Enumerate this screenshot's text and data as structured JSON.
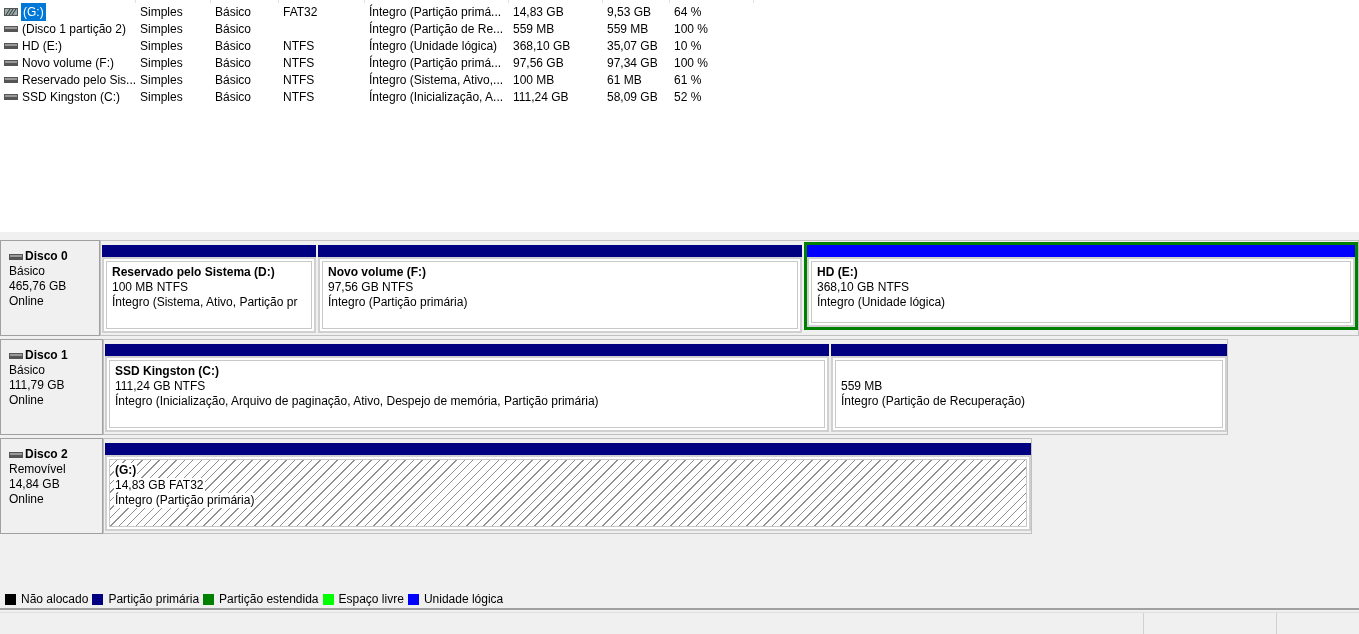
{
  "volumes": [
    {
      "name": "(G:)",
      "removable": true,
      "selected": true,
      "layout": "Simples",
      "type": "Básico",
      "fs": "FAT32",
      "status": "Íntegro (Partição primá...",
      "capacity": "14,83 GB",
      "free": "9,53 GB",
      "percent": "64 %"
    },
    {
      "name": "(Disco 1 partição 2)",
      "removable": false,
      "selected": false,
      "layout": "Simples",
      "type": "Básico",
      "status": "Íntegro (Partição de Re...",
      "capacity": "559 MB",
      "free": "559 MB",
      "percent": "100 %"
    },
    {
      "name": "HD (E:)",
      "removable": false,
      "selected": false,
      "layout": "Simples",
      "type": "Básico",
      "fs": "NTFS",
      "status": "Íntegro (Unidade lógica)",
      "capacity": "368,10 GB",
      "free": "35,07 GB",
      "percent": "10 %"
    },
    {
      "name": "Novo volume (F:)",
      "removable": false,
      "selected": false,
      "layout": "Simples",
      "type": "Básico",
      "fs": "NTFS",
      "status": "Íntegro (Partição primá...",
      "capacity": "97,56 GB",
      "free": "97,34 GB",
      "percent": "100 %"
    },
    {
      "name": "Reservado pelo Sis...",
      "removable": false,
      "selected": false,
      "layout": "Simples",
      "type": "Básico",
      "fs": "NTFS",
      "status": "Íntegro (Sistema, Ativo,...",
      "capacity": "100 MB",
      "free": "61 MB",
      "percent": "61 %"
    },
    {
      "name": "SSD Kingston (C:)",
      "removable": false,
      "selected": false,
      "layout": "Simples",
      "type": "Básico",
      "fs": "NTFS",
      "status": "Íntegro (Inicialização, A...",
      "capacity": "111,24 GB",
      "free": "58,09 GB",
      "percent": "52 %"
    }
  ],
  "disks": [
    {
      "name": "Disco 0",
      "type": "Básico",
      "size": "465,76 GB",
      "state": "Online",
      "partitions": [
        {
          "title": "Reservado pelo Sistema  (D:)",
          "size": "100 MB NTFS",
          "status": "Íntegro (Sistema, Ativo, Partição pr",
          "kind": "primary",
          "extended": false,
          "selected": false
        },
        {
          "title": "Novo volume  (F:)",
          "size": "97,56 GB NTFS",
          "status": "Íntegro (Partição primária)",
          "kind": "primary",
          "extended": false,
          "selected": false
        },
        {
          "title": "HD  (E:)",
          "size": "368,10 GB NTFS",
          "status": "Íntegro (Unidade lógica)",
          "kind": "logical",
          "extended": true,
          "selected": false
        }
      ]
    },
    {
      "name": "Disco 1",
      "type": "Básico",
      "size": "111,79 GB",
      "state": "Online",
      "partitions": [
        {
          "title": "SSD Kingston  (C:)",
          "size": "111,24 GB NTFS",
          "status": "Íntegro (Inicialização, Arquivo de paginação, Ativo, Despejo de memória, Partição primária)",
          "kind": "primary",
          "extended": false,
          "selected": false
        },
        {
          "size": "559 MB",
          "status": "Íntegro (Partição de Recuperação)",
          "kind": "primary",
          "extended": false,
          "selected": false
        }
      ]
    },
    {
      "name": "Disco 2",
      "type": "Removível",
      "size": "14,84 GB",
      "state": "Online",
      "partitions": [
        {
          "title": "(G:)",
          "size": "14,83 GB FAT32",
          "status": "Íntegro (Partição primária)",
          "kind": "primary",
          "extended": false,
          "selected": true
        }
      ]
    }
  ],
  "legend": [
    {
      "label": "Não alocado",
      "color": "#000000"
    },
    {
      "label": "Partição primária",
      "color": "#000080"
    },
    {
      "label": "Partição estendida",
      "color": "#008000"
    },
    {
      "label": "Espaço livre",
      "color": "#00ff00"
    },
    {
      "label": "Unidade lógica",
      "color": "#0000ff"
    }
  ]
}
